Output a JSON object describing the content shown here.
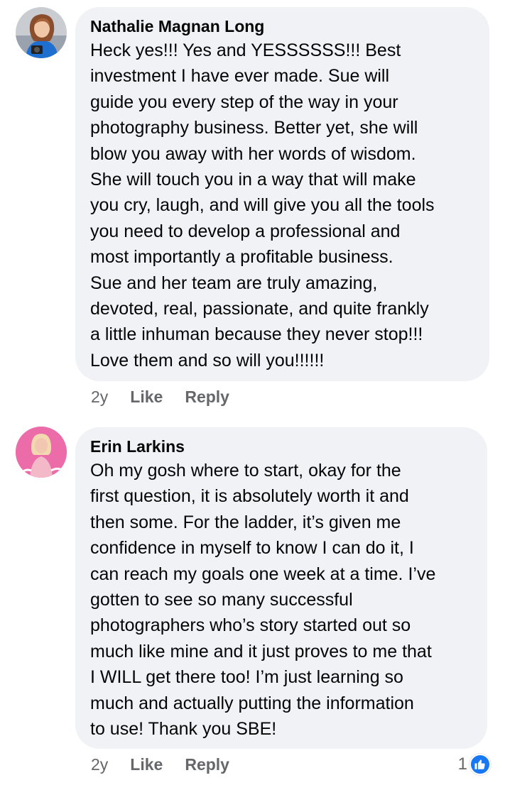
{
  "comments": [
    {
      "author": "Nathalie Magnan Long",
      "text": "Heck yes!!! Yes and YESSSSSS!!!  Best\ninvestment I have ever made.  Sue will\nguide you every step of the way in your\nphotography business. Better yet, she will\nblow you away with her words of wisdom.\nShe will touch you in a way that will make\nyou cry, laugh, and will give you all the tools\nyou need to develop a professional and\nmost importantly a profitable business.\nSue and her team are truly amazing,\ndevoted, real, passionate, and quite frankly\na little inhuman because they never stop!!!\nLove them and so will you!!!!!!",
      "time": "2y",
      "like_label": "Like",
      "reply_label": "Reply"
    },
    {
      "author": "Erin Larkins",
      "text": "Oh my gosh where to start, okay for the\nfirst question, it is absolutely worth it and\nthen some. For the ladder, it’s given me\nconfidence in myself to know I can do it, I\ncan reach my goals one week at a time. I’ve\ngotten to see so many successful\nphotographers who’s story started out so\nmuch like mine and it just proves to me that\nI WILL get there too! I’m just learning so\nmuch and actually putting the information\nto use! Thank you SBE!",
      "time": "2y",
      "like_label": "Like",
      "reply_label": "Reply",
      "reaction_count": "1",
      "reaction_icon": "thumbs-up-icon"
    }
  ],
  "colors": {
    "bubble_bg": "#f0f2f5",
    "meta_text": "#65676b",
    "like_blue": "#1877f2"
  }
}
